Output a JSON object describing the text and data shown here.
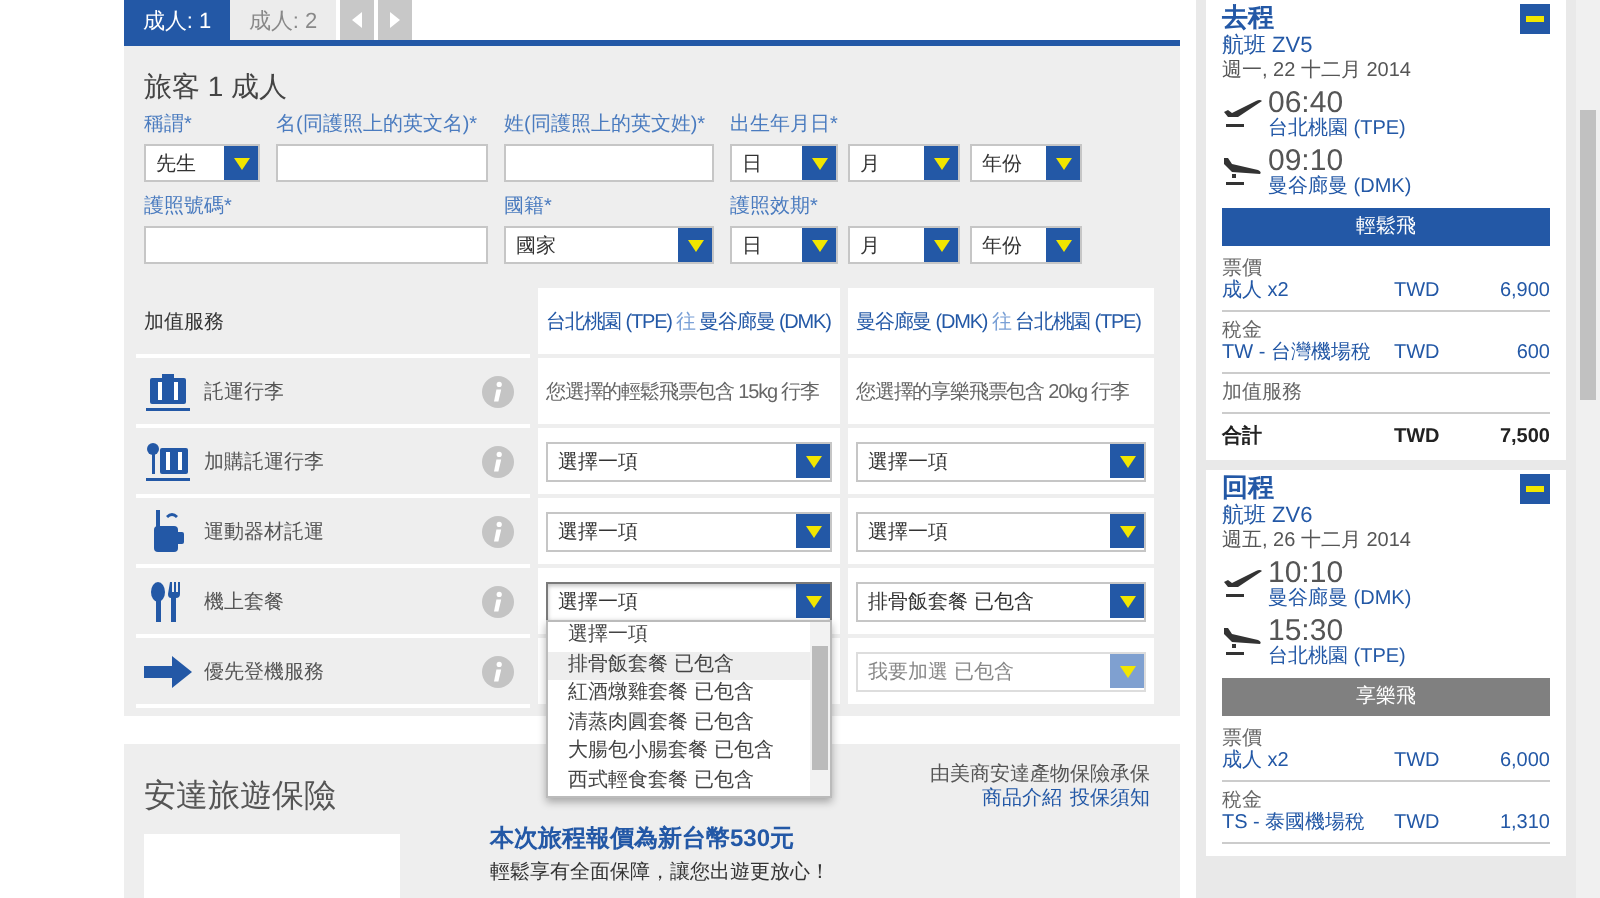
{
  "tabs": [
    {
      "label": "成人: 1",
      "selected": true
    },
    {
      "label": "成人: 2",
      "selected": false
    }
  ],
  "passenger": {
    "title": "旅客 1 成人",
    "fields": [
      {
        "kind": "select",
        "label": "稱謂*",
        "value": "先生"
      },
      {
        "kind": "input",
        "label": "名(同護照上的英文名)*"
      },
      {
        "kind": "input",
        "label": "姓(同護照上的英文姓)*"
      },
      {
        "kind": "date",
        "label": "出生年月日*",
        "parts": [
          "日",
          "月",
          "年份"
        ]
      },
      {
        "kind": "input",
        "label": "護照號碼*"
      },
      {
        "kind": "select",
        "label": "國籍*",
        "value": "國家"
      },
      {
        "kind": "date",
        "label": "護照效期*",
        "parts": [
          "日",
          "月",
          "年份"
        ]
      }
    ]
  },
  "addons": {
    "title": "加值服務",
    "routes": [
      {
        "from": "台北桃園 (TPE)",
        "joiner": "往",
        "to": "曼谷廊曼 (DMK)"
      },
      {
        "from": "曼谷廊曼 (DMK)",
        "joiner": "往",
        "to": "台北桃園 (TPE)"
      }
    ],
    "rows": [
      {
        "label": "託運行李",
        "cells": [
          {
            "kind": "text",
            "text": "您選擇的輕鬆飛票包含 15kg 行李"
          },
          {
            "kind": "text",
            "text": "您選擇的享樂飛票包含 20kg 行李"
          }
        ]
      },
      {
        "label": "加購託運行李",
        "cells": [
          {
            "kind": "select",
            "value": "選擇一項",
            "disabled": false,
            "expanded": false
          },
          {
            "kind": "select",
            "value": "選擇一項",
            "disabled": false,
            "expanded": false
          }
        ]
      },
      {
        "label": "運動器材託運",
        "cells": [
          {
            "kind": "select",
            "value": "選擇一項",
            "disabled": false,
            "expanded": false
          },
          {
            "kind": "select",
            "value": "選擇一項",
            "disabled": false,
            "expanded": false
          }
        ]
      },
      {
        "label": "機上套餐",
        "cells": [
          {
            "kind": "select",
            "value": "選擇一項",
            "disabled": false,
            "expanded": true
          },
          {
            "kind": "select",
            "value": "排骨飯套餐 已包含",
            "disabled": false,
            "expanded": false
          }
        ]
      },
      {
        "label": "優先登機服務",
        "cells": [
          {
            "kind": "blank"
          },
          {
            "kind": "select",
            "value": "我要加選 已包含",
            "disabled": true,
            "expanded": false
          }
        ]
      }
    ],
    "dropdown": {
      "options": [
        {
          "label": "選擇一項",
          "highlighted": false
        },
        {
          "label": "排骨飯套餐 已包含",
          "highlighted": true
        },
        {
          "label": "紅酒燉雞套餐 已包含",
          "highlighted": false
        },
        {
          "label": "清蒸肉圓套餐 已包含",
          "highlighted": false
        },
        {
          "label": "大腸包小腸套餐 已包含",
          "highlighted": false
        },
        {
          "label": "西式輕食套餐 已包含",
          "highlighted": false
        }
      ]
    }
  },
  "insurance": {
    "title": "安達旅遊保險",
    "insurer": "由美商安達產物保險承保",
    "links": [
      "商品介紹",
      "投保須知"
    ],
    "headline": "本次旅程報價為新台幣530元",
    "tagline": "輕鬆享有全面保障，讓您出遊更放心！"
  },
  "itinerary": [
    {
      "title": "去程",
      "flight": "航班 ZV5",
      "date": "週一, 22 十二月 2014",
      "segments": [
        {
          "kind": "departure",
          "time": "06:40",
          "airport": "台北桃園 (TPE)"
        },
        {
          "kind": "arrival",
          "time": "09:10",
          "airport": "曼谷廊曼 (DMK)"
        }
      ],
      "fare": {
        "label": "輕鬆飛",
        "color": "#2358a6"
      },
      "sections": [
        {
          "heading": "票價",
          "lines": [
            {
              "label": "成人 x2",
              "currency": "TWD",
              "amount": "6,900"
            }
          ]
        },
        {
          "heading": "稅金",
          "lines": [
            {
              "label": "TW - 台灣機場稅",
              "currency": "TWD",
              "amount": "600"
            }
          ]
        },
        {
          "heading": "加值服務"
        }
      ],
      "total": {
        "label": "合計",
        "currency": "TWD",
        "amount": "7,500"
      }
    },
    {
      "title": "回程",
      "flight": "航班 ZV6",
      "date": "週五, 26 十二月 2014",
      "segments": [
        {
          "kind": "departure",
          "time": "10:10",
          "airport": "曼谷廊曼 (DMK)"
        },
        {
          "kind": "arrival",
          "time": "15:30",
          "airport": "台北桃園 (TPE)"
        }
      ],
      "fare": {
        "label": "享樂飛",
        "color": "#808080"
      },
      "sections": [
        {
          "heading": "票價",
          "lines": [
            {
              "label": "成人 x2",
              "currency": "TWD",
              "amount": "6,000"
            }
          ]
        },
        {
          "heading": "稅金",
          "lines": [
            {
              "label": "TS - 泰國機場稅",
              "currency": "TWD",
              "amount": "1,310"
            }
          ]
        }
      ]
    }
  ]
}
